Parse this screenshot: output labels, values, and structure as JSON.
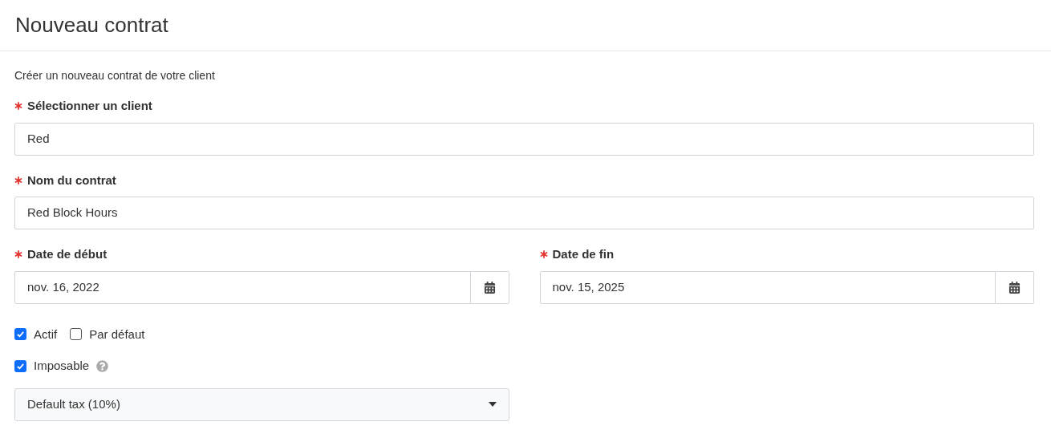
{
  "page": {
    "title": "Nouveau contrat",
    "description": "Créer un nouveau contrat de votre client"
  },
  "fields": [
    {
      "kind": "text",
      "label": "Sélectionner un client",
      "required": true,
      "value": "Red"
    },
    {
      "kind": "text",
      "label": "Nom du contrat",
      "required": true,
      "value": "Red Block Hours"
    }
  ],
  "dates": [
    {
      "label": "Date de début",
      "required": true,
      "value": "nov. 16, 2022"
    },
    {
      "label": "Date de fin",
      "required": true,
      "value": "nov. 15, 2025"
    }
  ],
  "checkbox_rows": [
    [
      {
        "label": "Actif",
        "checked": true,
        "help": false
      },
      {
        "label": "Par défaut",
        "checked": false,
        "help": false
      }
    ],
    [
      {
        "label": "Imposable",
        "checked": true,
        "help": true
      }
    ]
  ],
  "tax_select": {
    "value": "Default tax (10%)"
  }
}
